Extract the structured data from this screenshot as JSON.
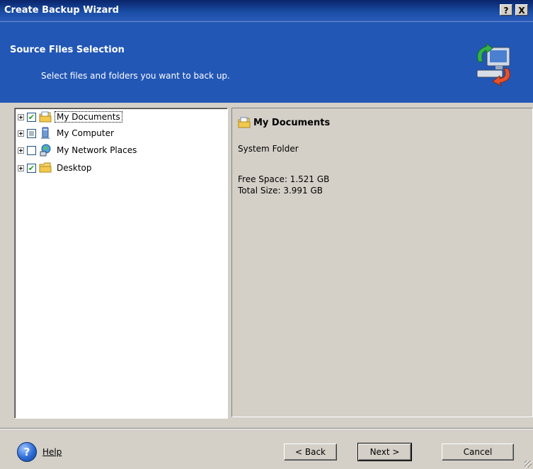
{
  "window": {
    "title": "Create Backup Wizard",
    "help_btn": "?",
    "close_btn": "X"
  },
  "header": {
    "title": "Source Files Selection",
    "subtitle": "Select files and folders you want to back up."
  },
  "tree": {
    "items": [
      {
        "label": "My Documents",
        "checked": "checked",
        "icon": "documents-folder-icon"
      },
      {
        "label": "My Computer",
        "checked": "partial",
        "icon": "computer-icon"
      },
      {
        "label": "My Network Places",
        "checked": "unchecked",
        "icon": "network-places-icon"
      },
      {
        "label": "Desktop",
        "checked": "checked",
        "icon": "desktop-folder-icon"
      }
    ]
  },
  "details": {
    "title": "My Documents",
    "type": "System Folder",
    "free_space": "Free Space: 1.521 GB",
    "total_size": "Total Size: 3.991 GB"
  },
  "footer": {
    "help_label": "Help",
    "back_label": "< Back",
    "next_label": "Next >",
    "cancel_label": "Cancel"
  },
  "colors": {
    "header_bg": "#2257b5",
    "dialog_bg": "#d4d0c8",
    "check_green": "#21a121"
  }
}
